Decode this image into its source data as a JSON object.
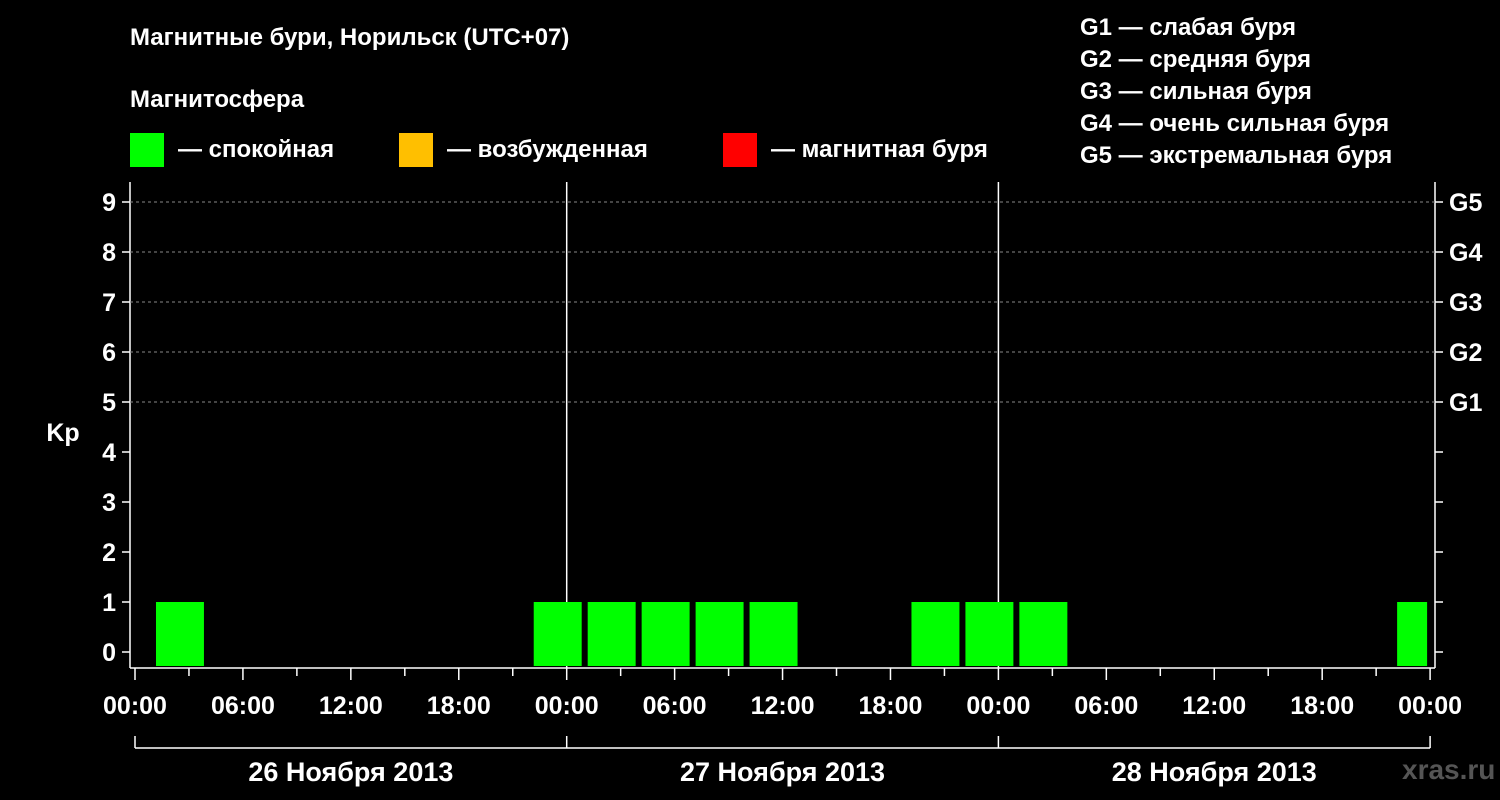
{
  "title": "Магнитные бури, Норильск (UTC+07)",
  "subtitle": "Магнитосфера",
  "legend": [
    {
      "color": "#00ff00",
      "label": "— спокойная"
    },
    {
      "color": "#ffbf00",
      "label": "— возбужденная"
    },
    {
      "color": "#ff0000",
      "label": "— магнитная буря"
    }
  ],
  "g_scale": [
    "G1 — слабая буря",
    "G2 — средняя буря",
    "G3 — сильная буря",
    "G4 — очень сильная буря",
    "G5 — экстремальная буря"
  ],
  "watermark": "xras.ru",
  "chart_data": {
    "type": "bar",
    "ylabel": "Kp",
    "ylim": [
      0,
      9
    ],
    "y_ticks": [
      0,
      1,
      2,
      3,
      4,
      5,
      6,
      7,
      8,
      9
    ],
    "right_axis_labels": [
      {
        "kp": 5,
        "label": "G1"
      },
      {
        "kp": 6,
        "label": "G2"
      },
      {
        "kp": 7,
        "label": "G3"
      },
      {
        "kp": 8,
        "label": "G4"
      },
      {
        "kp": 9,
        "label": "G5"
      }
    ],
    "x_tick_labels": [
      "00:00",
      "06:00",
      "12:00",
      "18:00",
      "00:00",
      "06:00",
      "12:00",
      "18:00",
      "00:00",
      "06:00",
      "12:00",
      "18:00",
      "00:00"
    ],
    "days": [
      "26 Ноября 2013",
      "27 Ноября 2013",
      "28 Ноября 2013"
    ],
    "grid": true,
    "bar_color": "#00ff00",
    "bars": [
      {
        "day": "26 Ноября 2013",
        "start": "01:00",
        "end": "04:00",
        "kp": 1
      },
      {
        "day": "26 Ноября 2013",
        "start": "22:00",
        "end": "01:00",
        "kp": 1
      },
      {
        "day": "27 Ноября 2013",
        "start": "01:00",
        "end": "04:00",
        "kp": 1
      },
      {
        "day": "27 Ноября 2013",
        "start": "04:00",
        "end": "07:00",
        "kp": 1
      },
      {
        "day": "27 Ноября 2013",
        "start": "07:00",
        "end": "10:00",
        "kp": 1
      },
      {
        "day": "27 Ноября 2013",
        "start": "10:00",
        "end": "13:00",
        "kp": 1
      },
      {
        "day": "27 Ноября 2013",
        "start": "19:00",
        "end": "22:00",
        "kp": 1
      },
      {
        "day": "27 Ноября 2013",
        "start": "22:00",
        "end": "01:00",
        "kp": 1
      },
      {
        "day": "28 Ноября 2013",
        "start": "01:00",
        "end": "04:00",
        "kp": 1
      },
      {
        "day": "28 Ноября 2013",
        "start": "22:00",
        "end": "24:00",
        "kp": 1
      }
    ]
  }
}
